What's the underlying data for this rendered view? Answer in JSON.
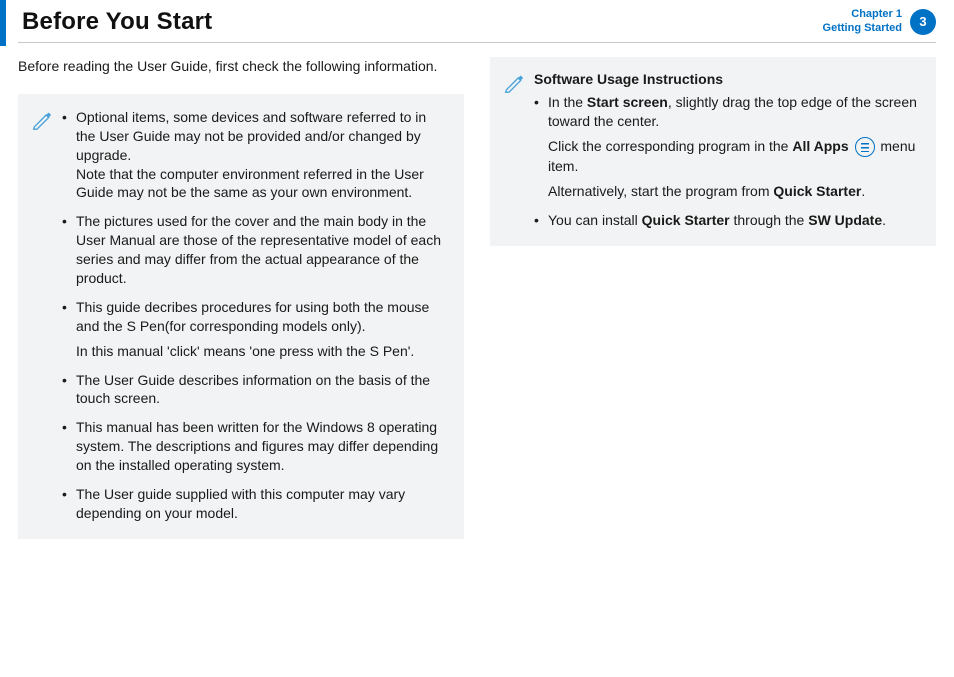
{
  "header": {
    "title": "Before You Start",
    "chapter_line1": "Chapter 1",
    "chapter_line2": "Getting Started",
    "page_number": "3"
  },
  "intro": "Before reading the User Guide, first check the following information.",
  "left_box": {
    "items": [
      {
        "text": "Optional items, some devices and software referred to in the User Guide may not be provided and/or changed by upgrade.",
        "sub": "Note that the computer environment referred in the User Guide may not be the same as your own environment."
      },
      {
        "text": "The pictures used for the cover and the main body in the User Manual are those of the representative model of each series and may differ from the actual appearance of the product."
      },
      {
        "text": "This guide decribes procedures for using both the mouse and the S Pen(for corresponding models only).",
        "sub": "In this manual 'click' means 'one press with the S Pen'."
      },
      {
        "text": "The User Guide describes information on the basis of the touch screen."
      },
      {
        "text": "This manual has been written for the Windows 8 operating system. The descriptions and figures may differ depending on the installed operating system."
      },
      {
        "text": "The User guide supplied with this computer may vary depending on your model."
      }
    ]
  },
  "right_box": {
    "title": "Software Usage Instructions",
    "item1_a": "In the ",
    "item1_b_bold": "Start screen",
    "item1_c": ", slightly drag the top edge of the screen toward the center.",
    "item1_sub1_a": "Click the corresponding program in the ",
    "item1_sub1_b_bold": "All Apps",
    "item1_sub1_c": " menu item.",
    "item1_sub2_a": "Alternatively, start the program from ",
    "item1_sub2_b_bold": "Quick Starter",
    "item1_sub2_c": ".",
    "item2_a": "You can install ",
    "item2_b_bold": "Quick Starter",
    "item2_c": " through the ",
    "item2_d_bold": "SW Update",
    "item2_e": "."
  }
}
